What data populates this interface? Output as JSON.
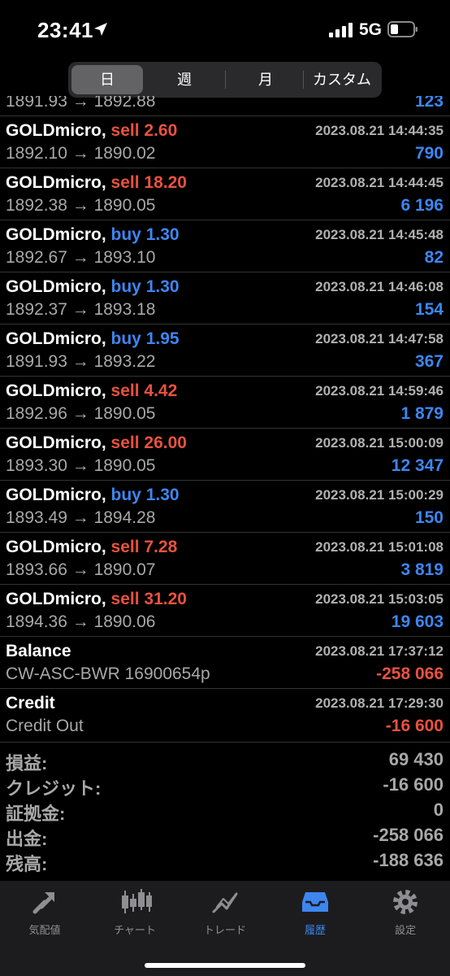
{
  "status": {
    "time": "23:41",
    "network": "5G"
  },
  "segments": [
    {
      "label": "日",
      "active": true
    },
    {
      "label": "週",
      "active": false
    },
    {
      "label": "月",
      "active": false
    },
    {
      "label": "カスタム",
      "active": false
    }
  ],
  "partial_row": {
    "prices": "1891.93 → 1892.88",
    "profit": "123"
  },
  "deals": [
    {
      "symbol": "GOLDmicro,",
      "side": "sell",
      "volume": "2.60",
      "date": "2023.08.21 14:44:35",
      "prices": "1892.10 → 1890.02",
      "profit": "790"
    },
    {
      "symbol": "GOLDmicro,",
      "side": "sell",
      "volume": "18.20",
      "date": "2023.08.21 14:44:45",
      "prices": "1892.38 → 1890.05",
      "profit": "6 196"
    },
    {
      "symbol": "GOLDmicro,",
      "side": "buy",
      "volume": "1.30",
      "date": "2023.08.21 14:45:48",
      "prices": "1892.67 → 1893.10",
      "profit": "82"
    },
    {
      "symbol": "GOLDmicro,",
      "side": "buy",
      "volume": "1.30",
      "date": "2023.08.21 14:46:08",
      "prices": "1892.37 → 1893.18",
      "profit": "154"
    },
    {
      "symbol": "GOLDmicro,",
      "side": "buy",
      "volume": "1.95",
      "date": "2023.08.21 14:47:58",
      "prices": "1891.93 → 1893.22",
      "profit": "367"
    },
    {
      "symbol": "GOLDmicro,",
      "side": "sell",
      "volume": "4.42",
      "date": "2023.08.21 14:59:46",
      "prices": "1892.96 → 1890.05",
      "profit": "1 879"
    },
    {
      "symbol": "GOLDmicro,",
      "side": "sell",
      "volume": "26.00",
      "date": "2023.08.21 15:00:09",
      "prices": "1893.30 → 1890.05",
      "profit": "12 347"
    },
    {
      "symbol": "GOLDmicro,",
      "side": "buy",
      "volume": "1.30",
      "date": "2023.08.21 15:00:29",
      "prices": "1893.49 → 1894.28",
      "profit": "150"
    },
    {
      "symbol": "GOLDmicro,",
      "side": "sell",
      "volume": "7.28",
      "date": "2023.08.21 15:01:08",
      "prices": "1893.66 → 1890.07",
      "profit": "3 819"
    },
    {
      "symbol": "GOLDmicro,",
      "side": "sell",
      "volume": "31.20",
      "date": "2023.08.21 15:03:05",
      "prices": "1894.36 → 1890.06",
      "profit": "19 603"
    }
  ],
  "balance_ops": [
    {
      "title": "Balance",
      "date": "2023.08.21 17:37:12",
      "comment": "CW-ASC-BWR 16900654p",
      "amount": "-258 066"
    },
    {
      "title": "Credit",
      "date": "2023.08.21 17:29:30",
      "comment": "Credit Out",
      "amount": "-16 600"
    }
  ],
  "summary": [
    {
      "label": "損益:",
      "value": "69 430"
    },
    {
      "label": "クレジット:",
      "value": "-16 600"
    },
    {
      "label": "証拠金:",
      "value": "0"
    },
    {
      "label": "出金:",
      "value": "-258 066"
    },
    {
      "label": "残高:",
      "value": "-188 636"
    }
  ],
  "tabs": [
    {
      "label": "気配値",
      "icon": "quotes-icon",
      "active": false
    },
    {
      "label": "チャート",
      "icon": "chart-icon",
      "active": false
    },
    {
      "label": "トレード",
      "icon": "trade-icon",
      "active": false
    },
    {
      "label": "履歴",
      "icon": "history-icon",
      "active": true
    },
    {
      "label": "設定",
      "icon": "settings-icon",
      "active": false
    }
  ],
  "colors": {
    "sell": "#e8523f",
    "buy": "#3d86f0",
    "profit": "#3d86f0",
    "loss": "#e8523f",
    "active_tab": "#3d86f0"
  }
}
